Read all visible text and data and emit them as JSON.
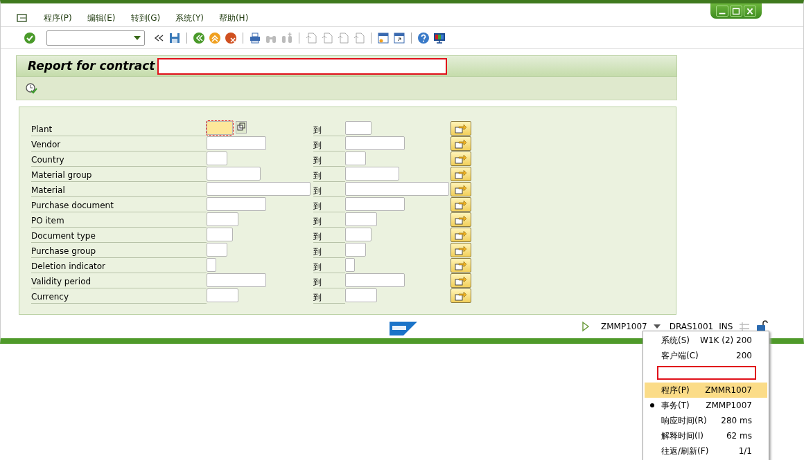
{
  "menu": [
    "程序(P)",
    "编辑(E)",
    "转到(G)",
    "系统(Y)",
    "帮助(H)"
  ],
  "title": "Report for contract",
  "form": {
    "to_label_rows": [
      {
        "label": "Plant",
        "to": "到",
        "focused": true
      },
      {
        "label": "Vendor",
        "to": "到",
        "focused": false
      },
      {
        "label": "Country",
        "to": "到",
        "focused": false
      },
      {
        "label": "Material group",
        "to": "到",
        "focused": false
      },
      {
        "label": "Material",
        "to": "到",
        "focused": false
      },
      {
        "label": "Purchase document",
        "to": "到",
        "focused": false
      },
      {
        "label": "PO item",
        "to": "到",
        "focused": false
      },
      {
        "label": "Document type",
        "to": "到",
        "focused": false
      },
      {
        "label": "Purchase group",
        "to": "到",
        "focused": false
      },
      {
        "label": "Deletion indicator",
        "to": "到",
        "focused": false
      },
      {
        "label": "Validity period",
        "to": "到",
        "focused": false
      },
      {
        "label": "Currency",
        "to": "到",
        "focused": false
      }
    ]
  },
  "status_bar": {
    "transaction": "ZMMP1007",
    "server": "DRAS1001",
    "mode": "INS"
  },
  "popup": [
    {
      "label": "系统(S)",
      "value": "W1K (2) 200",
      "highlighted": false,
      "checked": false
    },
    {
      "label": "客户端(C)",
      "value": "200",
      "highlighted": false,
      "checked": false
    },
    {
      "kind": "redacted"
    },
    {
      "label": "程序(P)",
      "value": "ZMMR1007",
      "highlighted": true,
      "checked": false
    },
    {
      "label": "事务(T)",
      "value": "ZMMP1007",
      "highlighted": false,
      "checked": true
    },
    {
      "label": "响应时间(R)",
      "value": "280 ms",
      "highlighted": false,
      "checked": false
    },
    {
      "label": "解释时间(I)",
      "value": "62 ms",
      "highlighted": false,
      "checked": false
    },
    {
      "label": "往返/刷新(F)",
      "value": "1/1",
      "highlighted": false,
      "checked": false
    }
  ]
}
